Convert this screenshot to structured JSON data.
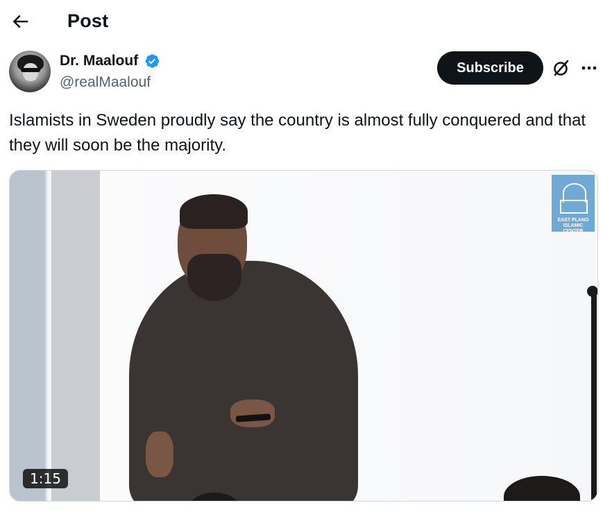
{
  "header": {
    "title": "Post"
  },
  "author": {
    "name": "Dr. Maalouf",
    "handle": "@realMaalouf",
    "verified": true
  },
  "actions": {
    "subscribe_label": "Subscribe"
  },
  "tweet": {
    "text": "Islamists in Sweden proudly say the country is almost fully conquered and that they will soon be the majority."
  },
  "media": {
    "type": "video",
    "duration": "1:15",
    "watermark_text": "EAST PLANO ISLAMIC CENTER"
  },
  "colors": {
    "text": "#0f1419",
    "secondary": "#536471",
    "verified": "#1d9bf0",
    "button_bg": "#0f1419"
  },
  "icons": {
    "back": "arrow-left-icon",
    "verified": "verified-badge-icon",
    "grok": "grok-icon",
    "more": "more-horizontal-icon"
  }
}
